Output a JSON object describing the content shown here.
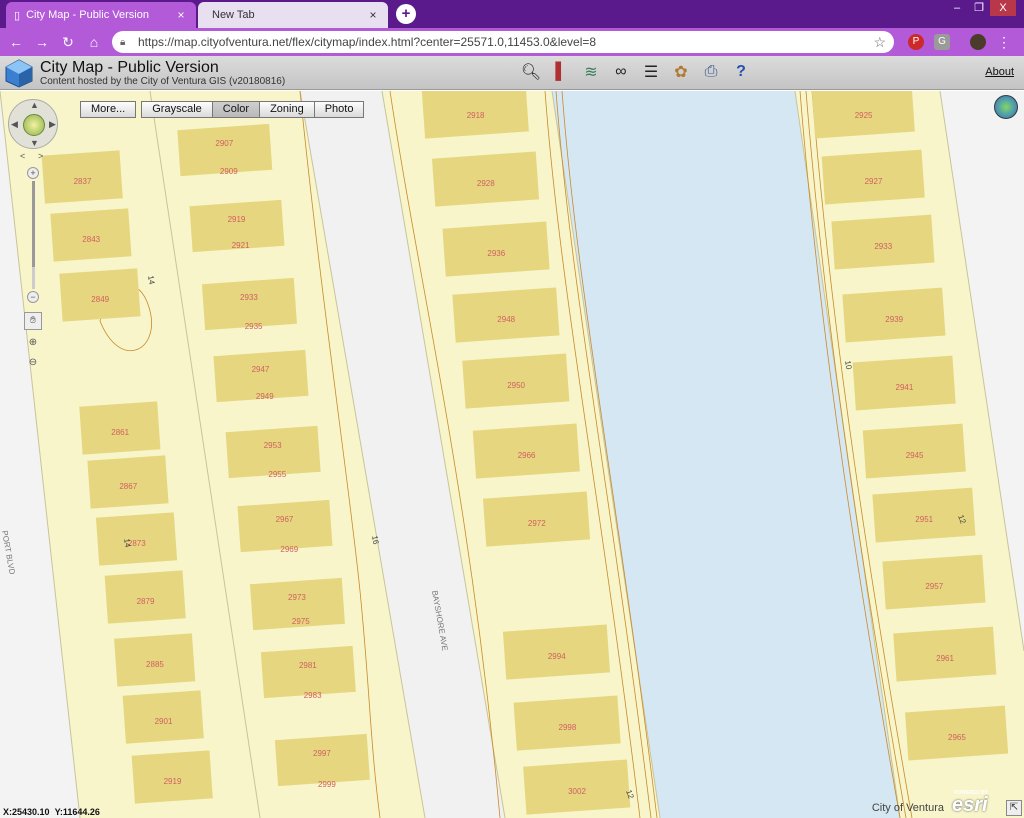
{
  "browser": {
    "tabs": [
      {
        "title": "City Map - Public Version",
        "active": true
      },
      {
        "title": "New Tab",
        "active": false
      }
    ],
    "close_glyph": "×",
    "new_tab_glyph": "+",
    "window": {
      "minimize": "–",
      "maximize": "❐",
      "close": "X"
    },
    "nav": {
      "back": "←",
      "forward": "→",
      "reload": "↻",
      "home": "⌂"
    },
    "url": "https://map.cityofventura.net/flex/citymap/index.html?center=25571.0,11453.0&level=8",
    "icons": [
      "lock-icon",
      "star-icon",
      "pinterest-icon",
      "extension-icon",
      "profile-avatar",
      "menu-icon"
    ]
  },
  "app": {
    "title": "City Map - Public Version",
    "subtitle": "Content hosted by the City of Ventura GIS (v20180816)",
    "about": "About",
    "tools": [
      "search-icon",
      "bookmark-icon",
      "layers-icon",
      "binoculars-icon",
      "legend-icon",
      "palette-icon",
      "print-icon",
      "help-icon"
    ]
  },
  "map": {
    "basemap": {
      "more": "More...",
      "options": [
        "Grayscale",
        "Color",
        "Zoning",
        "Photo"
      ],
      "selected": "Color"
    },
    "zoom_level_fraction": 0.8,
    "coordinates": {
      "x": "X:25430.10",
      "y": "Y:11644.26"
    },
    "credit": "City of Ventura",
    "esri_powered": "POWERED BY",
    "esri_word": "esri",
    "streets": {
      "harbor": "PORT BLVD",
      "bayshore": "BAYSHORE AVE"
    },
    "contour_labels": [
      "14",
      "14",
      "16",
      "10",
      "12",
      "12"
    ],
    "lot_numbers": {
      "column_a": [
        "2837",
        "2843",
        "2849",
        "2861",
        "2867",
        "2873",
        "2879",
        "2885",
        "2901",
        "2919"
      ],
      "column_b": [
        "2907",
        "2909",
        "2919",
        "2921",
        "2933",
        "2935",
        "2947",
        "2949",
        "2953",
        "2955",
        "2967",
        "2969",
        "2973",
        "2975",
        "2981",
        "2983",
        "2997",
        "2999"
      ],
      "column_c": [
        "2918",
        "2928",
        "2936",
        "2948",
        "2950",
        "2966",
        "2972",
        "2994",
        "2998",
        "3002"
      ],
      "column_d": [
        "2925",
        "2927",
        "2933",
        "2939",
        "2941",
        "2945",
        "2951",
        "2957",
        "2961",
        "2965"
      ]
    }
  },
  "colors": {
    "chrome": "#5a1a8c",
    "parcel": "#f7f5c9",
    "building": "#e6d67f",
    "water": "#d5e7f2",
    "lot_label": "#d06060",
    "contour": "#c98a2b"
  }
}
